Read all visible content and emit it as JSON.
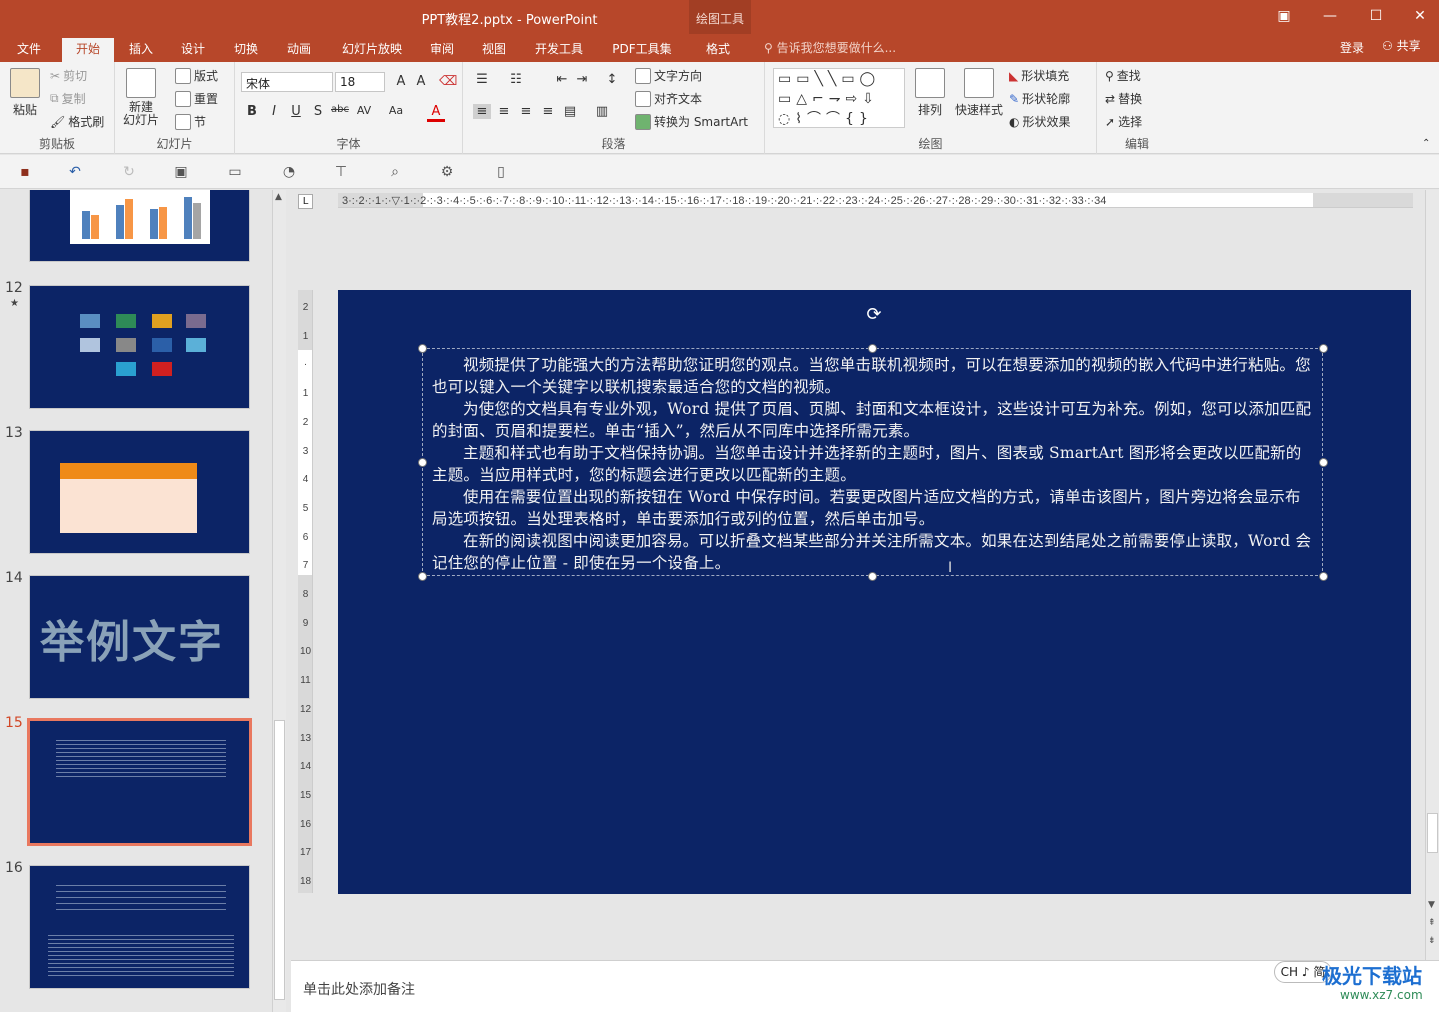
{
  "window": {
    "title": "PPT教程2.pptx - PowerPoint",
    "context_tool": "绘图工具",
    "controls": [
      "□",
      "—",
      "☐",
      "✕"
    ]
  },
  "tabs": [
    "文件",
    "开始",
    "插入",
    "设计",
    "切换",
    "动画",
    "幻灯片放映",
    "审阅",
    "视图",
    "开发工具",
    "PDF工具集",
    "格式"
  ],
  "active_tab": "开始",
  "tell_me": "告诉我您想要做什么...",
  "account": {
    "login": "登录",
    "share": "共享"
  },
  "ribbon": {
    "clipboard": {
      "label": "剪贴板",
      "paste": "粘贴",
      "cut": "剪切",
      "copy": "复制",
      "format_painter": "格式刷"
    },
    "slides": {
      "label": "幻灯片",
      "new_slide": "新建\n幻灯片",
      "layout": "版式",
      "reset": "重置",
      "section": "节"
    },
    "font": {
      "label": "字体",
      "font_name": "宋体",
      "font_size": "18"
    },
    "paragraph": {
      "label": "段落",
      "text_direction": "文字方向",
      "align_text": "对齐文本",
      "convert_smartart": "转换为 SmartArt"
    },
    "drawing": {
      "label": "绘图",
      "arrange": "排列",
      "quick_styles": "快速样式",
      "shape_fill": "形状填充",
      "shape_outline": "形状轮廓",
      "shape_effects": "形状效果"
    },
    "editing": {
      "label": "编辑",
      "find": "查找",
      "replace": "替换",
      "select": "选择"
    }
  },
  "thumbnails": [
    {
      "number": "12",
      "star": "★"
    },
    {
      "number": "13"
    },
    {
      "number": "14",
      "text": "举例文字"
    },
    {
      "number": "15",
      "selected": true
    },
    {
      "number": "16"
    }
  ],
  "slide": {
    "paragraphs": [
      "视频提供了功能强大的方法帮助您证明您的观点。当您单击联机视频时，可以在想要添加的视频的嵌入代码中进行粘贴。您也可以键入一个关键字以联机搜索最适合您的文档的视频。",
      "为使您的文档具有专业外观，Word 提供了页眉、页脚、封面和文本框设计，这些设计可互为补充。例如，您可以添加匹配的封面、页眉和提要栏。单击“插入”，然后从不同库中选择所需元素。",
      "主题和样式也有助于文档保持协调。当您单击设计并选择新的主题时，图片、图表或 SmartArt 图形将会更改以匹配新的主题。当应用样式时，您的标题会进行更改以匹配新的主题。",
      "使用在需要位置出现的新按钮在 Word 中保存时间。若要更改图片适应文档的方式，请单击该图片，图片旁边将会显示布局选项按钮。当处理表格时，单击要添加行或列的位置，然后单击加号。",
      "在新的阅读视图中阅读更加容易。可以折叠文档某些部分并关注所需文本。如果在达到结尾处之前需要停止读取，Word 会记住您的停止位置 - 即使在另一个设备上。"
    ],
    "background": "#0c2466"
  },
  "notes_placeholder": "单击此处添加备注",
  "ime": "CH ♪ 简",
  "watermark": {
    "main": "极光下载站",
    "url": "www.xz7.com"
  },
  "colors": {
    "accent": "#b7472a",
    "slide_bg": "#0c2466",
    "selected_thumb_border": "#e9785f"
  }
}
